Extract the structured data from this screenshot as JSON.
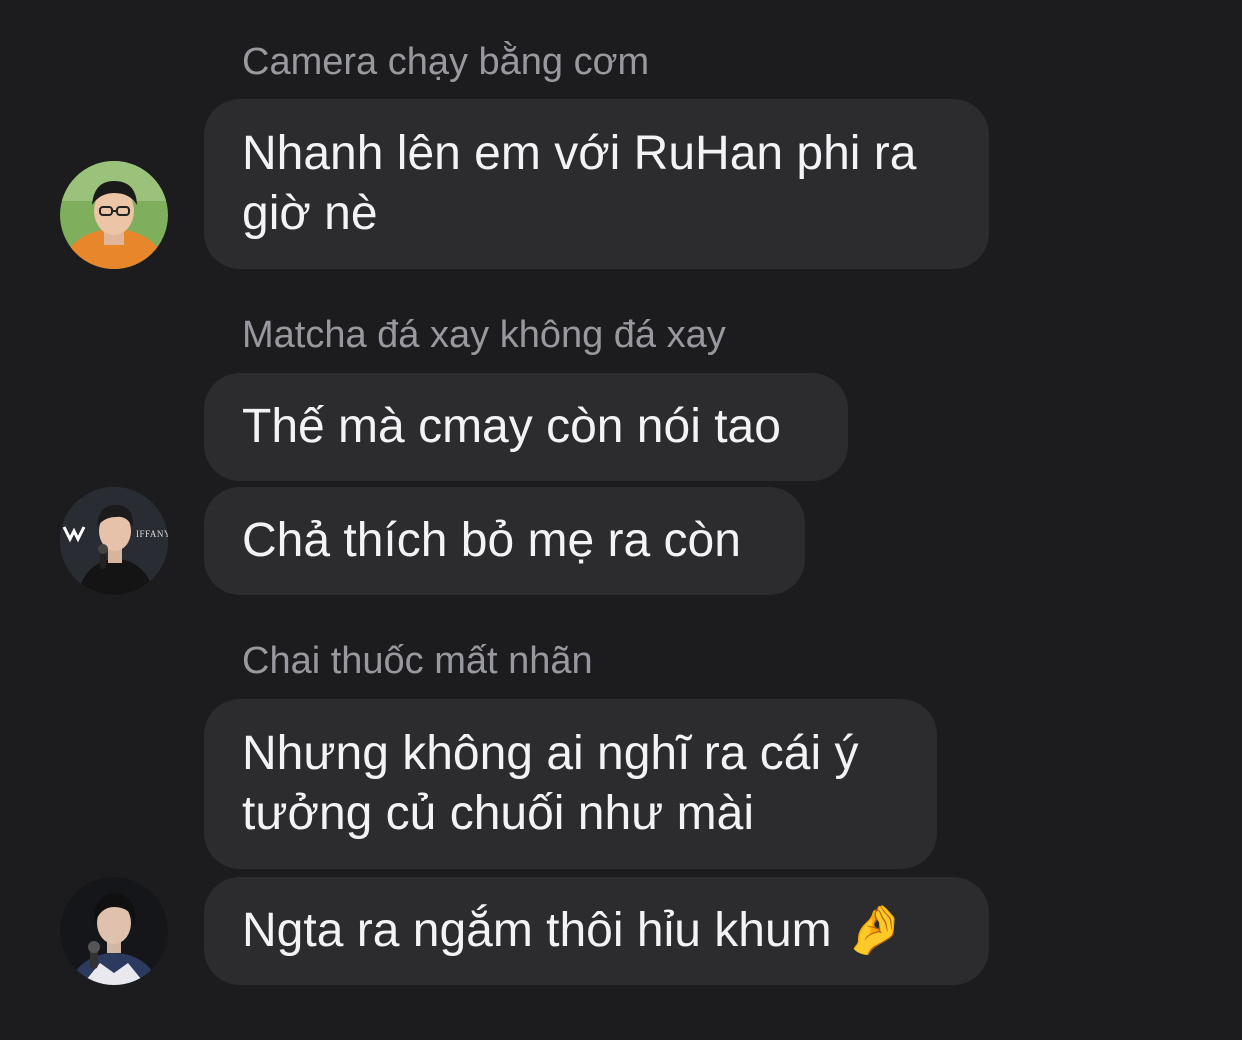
{
  "groups": [
    {
      "sender": "Camera chạy bằng cơm",
      "messages": [
        "Nhanh lên em với RuHan phi ra giờ nè"
      ]
    },
    {
      "sender": "Matcha đá xay không đá xay",
      "messages": [
        "Thế mà cmay còn nói tao",
        "Chả thích bỏ mẹ ra còn"
      ]
    },
    {
      "sender": "Chai thuốc mất nhãn",
      "messages": [
        "Nhưng không ai nghĩ ra cái ý tưởng củ chuối như mài",
        "Ngta ra ngắm thôi hỉu khum 🤌"
      ]
    }
  ],
  "avatar_badge_text": "IFFANY",
  "colors": {
    "background": "#1c1c1e",
    "bubble": "#2c2c2e",
    "sender_text": "#98989f",
    "message_text": "#f2f2f7"
  }
}
